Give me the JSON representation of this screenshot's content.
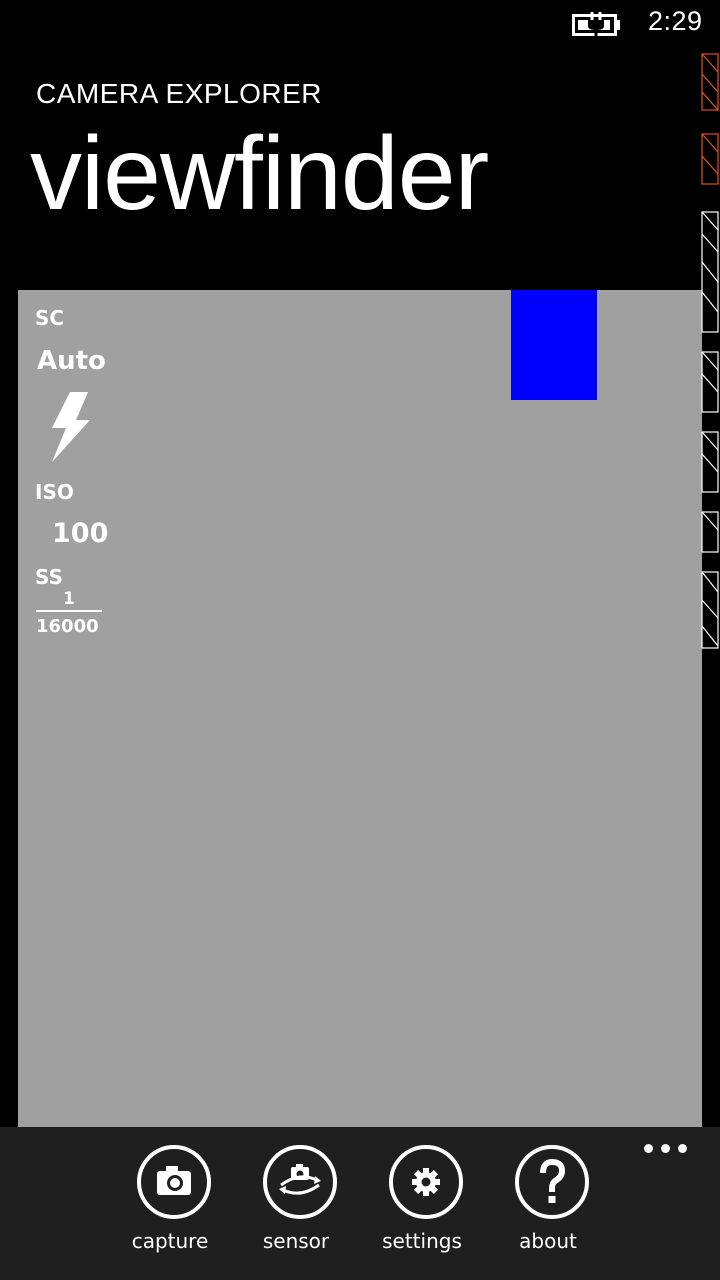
{
  "status": {
    "time": "2:29"
  },
  "header": {
    "app_title": "CAMERA EXPLORER",
    "page_title": "viewfinder"
  },
  "overlay": {
    "sc_label": "SC",
    "sc_value": "Auto",
    "iso_label": "ISO",
    "iso_value": "100",
    "ss_label": "SS",
    "ss_numerator": "1",
    "ss_denominator": "16000"
  },
  "colors": {
    "viewfinder_bg": "#a0a0a0",
    "focus_rect": "#0000ff",
    "app_bar_bg": "#1f1f1f"
  },
  "app_bar": {
    "buttons": [
      {
        "label": "capture",
        "icon": "camera-icon"
      },
      {
        "label": "sensor",
        "icon": "switch-camera-icon"
      },
      {
        "label": "settings",
        "icon": "gear-icon"
      },
      {
        "label": "about",
        "icon": "question-icon"
      }
    ]
  }
}
